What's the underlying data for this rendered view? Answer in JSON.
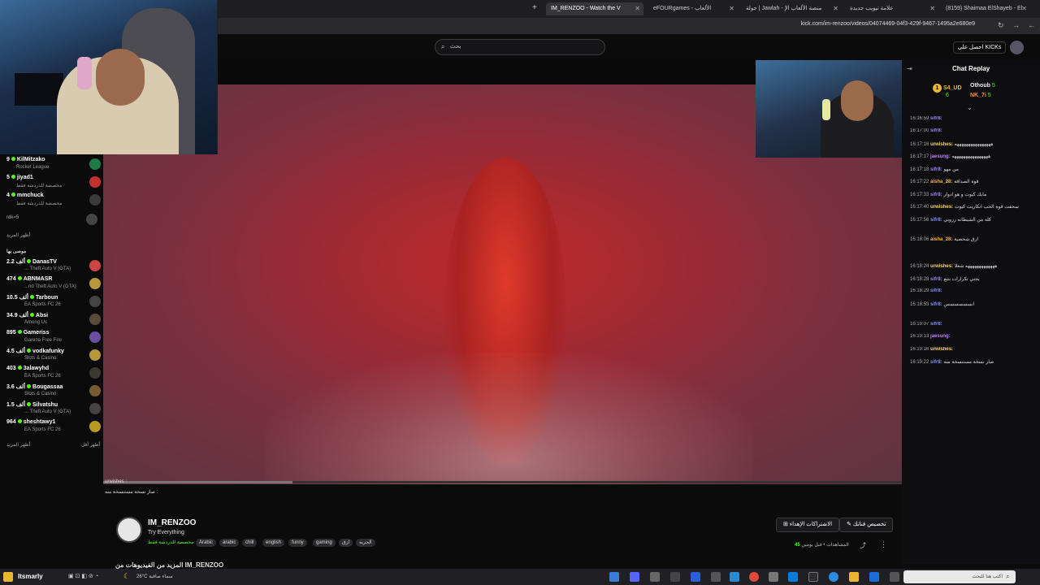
{
  "browser": {
    "tabs": [
      {
        "label": "IM_RENZOO - Watch the V",
        "active": true
      },
      {
        "label": "eFOURgames - الألعاب",
        "active": false
      },
      {
        "label": "جولة | Jawlah - منصة الألعاب الإ",
        "active": false
      },
      {
        "label": "علامة تبويب جديدة",
        "active": false
      },
      {
        "label": "(8159) Shaimaa ElShayeb - El",
        "active": false
      }
    ],
    "url": "kick.com/im-renzoo/videos/04074469-04f3-429f-9467-1495a2e680e9"
  },
  "kick": {
    "search_placeholder": "بحث",
    "get_kicks_label": "احصل على KICKs"
  },
  "sidebar": {
    "top_channels": [
      {
        "name": "KilMitzako",
        "viewers": "9",
        "game": "Rocket League"
      },
      {
        "name": "jiyad1",
        "viewers": "5",
        "game": "مخصصة للدردشة فقط"
      },
      {
        "name": "mmchuck",
        "viewers": "4",
        "game": "مخصصة للدردشة فقط"
      }
    ],
    "hidden_entry": "rdk=5",
    "show_more_1": "أظهر المزيد",
    "recommended_header": "موصى بها",
    "recommended": [
      {
        "name": "DanasTV",
        "viewers": "2.2 ألف",
        "game": "... Theft Auto V (GTA)"
      },
      {
        "name": "ABNMASR",
        "viewers": "474",
        "game": "...nd Theft Auto V (GTA)"
      },
      {
        "name": "Tarboun",
        "viewers": "10.5 ألف",
        "game": "EA Sports FC 26"
      },
      {
        "name": "Absi",
        "viewers": "34.9 ألف",
        "game": "Among Us"
      },
      {
        "name": "Gameriss",
        "viewers": "895",
        "game": "Garena Free Fire"
      },
      {
        "name": "vodkafunky",
        "viewers": "4.5 ألف",
        "game": "Slots & Casino"
      },
      {
        "name": "3alawyhd",
        "viewers": "403",
        "game": "EA Sports FC 26"
      },
      {
        "name": "Bougassaa",
        "viewers": "3.6 ألف",
        "game": "Slots & Casino"
      },
      {
        "name": "Silvatshu",
        "viewers": "1.5 ألف",
        "game": "... Theft Auto V (GTA)"
      },
      {
        "name": "sheshtawy1",
        "viewers": "964",
        "game": "EA Sports FC 26"
      }
    ],
    "show_more_2": "أظهر المزيد",
    "show_less": "أظهر أقل"
  },
  "video": {
    "overlay_user": "urwishes :",
    "overlay_text": "صار نسخة مستنسخة منه :"
  },
  "channel": {
    "name": "IM_RENZOO",
    "title": "Try Everything",
    "category": "مخصصة للدردشة فقط",
    "tags": [
      "Arabic",
      "arabic",
      "chill",
      "english",
      "funny",
      "gaming",
      "ازق",
      "الحريه"
    ],
    "more_videos": "المزيد من الفيديوهات من IM_RENZOO",
    "subscribe_label": "الاشتراكات الإهداء",
    "customize_label": "تخصيص قناتك",
    "views_count": "45",
    "views_label": "المشاهدات",
    "time_ago": "قبل يومين"
  },
  "chat": {
    "title": "Chat Replay",
    "top_gifters": [
      {
        "name": "S4_UD",
        "count": "6"
      },
      {
        "name": "Othoub",
        "count": "5"
      },
      {
        "name": "NK_7i",
        "count": "5"
      }
    ],
    "messages": [
      {
        "time": "16:16:59",
        "user": "sifr8:",
        "text": "",
        "color": "#8d8dff"
      },
      {
        "time": "16:17:00",
        "user": "sifr8:",
        "text": "",
        "color": "#8d8dff"
      },
      {
        "time": "16:17:16",
        "user": "urwishes:",
        "text": "ههههههههههههههههه",
        "color": "#ffd84d"
      },
      {
        "time": "16:17:17",
        "user": "jaesung:",
        "text": "ههههههههههههههههه",
        "color": "#c57bff"
      },
      {
        "time": "16:17:18",
        "user": "sifr8:",
        "text": "من مهو",
        "color": "#8d8dff"
      },
      {
        "time": "16:17:22",
        "user": "aisha_28:",
        "text": "قوة الصداقة",
        "color": "#ffb63d"
      },
      {
        "time": "16:17:33",
        "user": "sifr8:",
        "text": "مايك كيوت و هو ادوار",
        "color": "#8d8dff"
      },
      {
        "time": "16:17:40",
        "user": "urwishes:",
        "text": "سحقت قوة الحب انكاريت كيوت",
        "color": "#ffd84d"
      },
      {
        "time": "16:17:56",
        "user": "sifr8:",
        "text": "كله من الشيطانه رزوبي",
        "color": "#8d8dff"
      },
      {
        "time": "16:18:06",
        "user": "aisha_28:",
        "text": "ازق شخصية",
        "color": "#ffb63d"
      },
      {
        "time": "16:18:24",
        "user": "urwishes:",
        "text": "هههههههههههههه شغلا",
        "color": "#ffd84d"
      },
      {
        "time": "16:18:28",
        "user": "sifr8:",
        "text": "يحني تكرارات بتبع",
        "color": "#8d8dff"
      },
      {
        "time": "16:18:29",
        "user": "sifr8:",
        "text": "",
        "color": "#8d8dff"
      },
      {
        "time": "16:18:53",
        "user": "sifr8:",
        "text": "انسسسسسس",
        "color": "#8d8dff"
      },
      {
        "time": "16:19:07",
        "user": "sifr8:",
        "text": "",
        "color": "#8d8dff"
      },
      {
        "time": "16:19:13",
        "user": "jaesung:",
        "text": "",
        "color": "#c57bff"
      },
      {
        "time": "16:19:16",
        "user": "urwishes:",
        "text": "",
        "color": "#ffd84d"
      },
      {
        "time": "16:19:22",
        "user": "sifr8:",
        "text": "صار نسخة مستنسخة منه",
        "color": "#8d8dff"
      }
    ]
  },
  "taskbar": {
    "user": "Itsmarly",
    "weather_temp": "26°C",
    "weather_label": "سماء صافية",
    "search_placeholder": "اكتب هنا للبحث"
  },
  "colors": {
    "accent": "#53fc18",
    "background": "#0b0b0c"
  }
}
